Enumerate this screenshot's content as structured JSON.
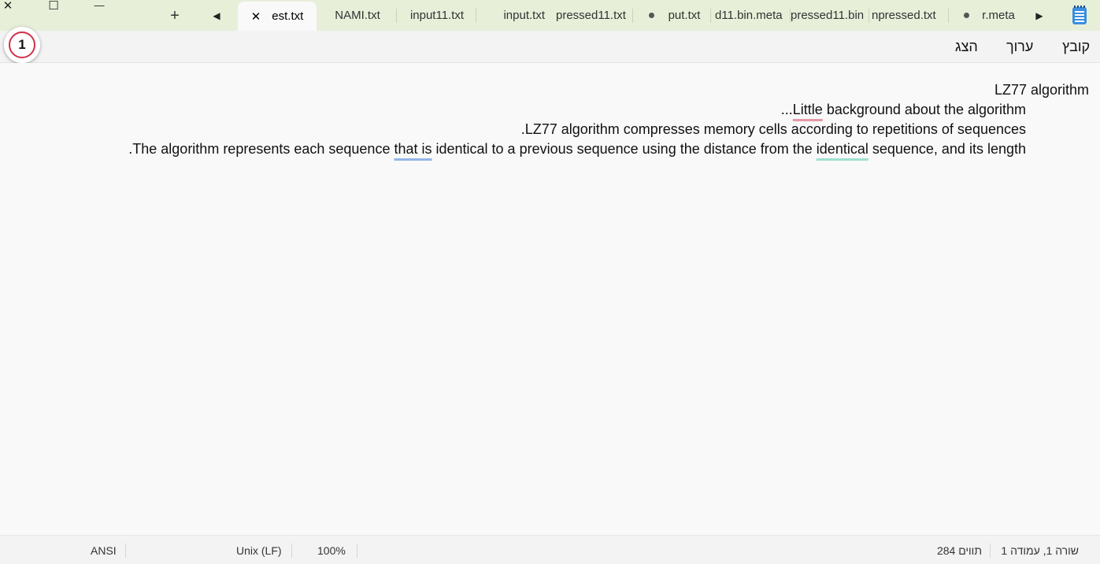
{
  "window": {
    "close_glyph": "✕",
    "maximize_glyph": "☐",
    "minimize_glyph": "—"
  },
  "tabs": {
    "new_tab_glyph": "+",
    "scroll_left_glyph": "◀",
    "scroll_right_glyph": "▶",
    "tab_close_glyph": "✕",
    "items": [
      {
        "label": "est.txt",
        "active": true
      },
      {
        "label": "NAMI.txt"
      },
      {
        "label": "input11.txt"
      },
      {
        "label": "input.txt"
      },
      {
        "label": "pressed11.txt"
      },
      {
        "label": "put.txt",
        "unsaved": true
      },
      {
        "label": "d11.bin.meta"
      },
      {
        "label": "pressed11.bin"
      },
      {
        "label": "npressed.txt"
      },
      {
        "label": "r.meta",
        "unsaved": true
      }
    ]
  },
  "menu": {
    "file": "קובץ",
    "edit": "ערוך",
    "view": "הצג"
  },
  "overlay_badge": {
    "number": "1",
    "accent": "#d0304a"
  },
  "document": {
    "line1": "LZ77 algorithm",
    "line2_pre": "",
    "line2_word": "Little",
    "line2_post": " background about the algorithm",
    "line2_tail": "...",
    "line3": ".LZ77 algorithm compresses memory cells according to repetitions of sequences",
    "line4_a": ".The algorithm represents each sequence ",
    "line4_b": "that is",
    "line4_c": " identical to a previous sequence using the distance from the ",
    "line4_d": "identical",
    "line4_e": " sequence, and its length"
  },
  "status": {
    "position": "שורה 1, עמודה 1",
    "char_count": "284 תווים",
    "zoom": "100%",
    "line_ending": "Unix (LF)",
    "encoding": "ANSI"
  },
  "colors": {
    "titlebar": "#e7efd9",
    "squiggle_spelling": "#e69aa5",
    "squiggle_grammar": "#93b6e6",
    "squiggle_suggestion": "#9fe0cf"
  }
}
